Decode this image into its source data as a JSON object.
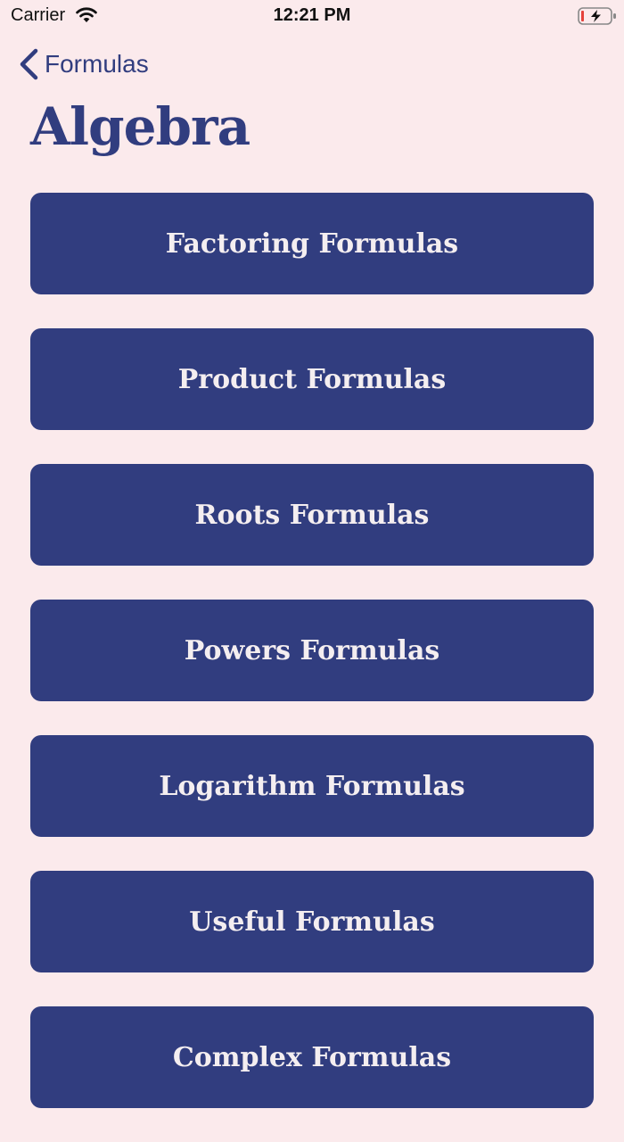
{
  "status_bar": {
    "carrier": "Carrier",
    "time": "12:21 PM",
    "wifi_icon": "wifi-icon",
    "battery_icon": "battery-charging-icon"
  },
  "nav": {
    "back_label": "Formulas",
    "back_icon": "chevron-left-icon"
  },
  "page": {
    "title": "Algebra"
  },
  "buttons": [
    {
      "label": "Factoring Formulas"
    },
    {
      "label": "Product Formulas"
    },
    {
      "label": "Roots Formulas"
    },
    {
      "label": "Powers Formulas"
    },
    {
      "label": "Logarithm Formulas"
    },
    {
      "label": "Useful Formulas"
    },
    {
      "label": "Complex Formulas"
    }
  ],
  "colors": {
    "background": "#fbeaec",
    "accent": "#313d7f",
    "button_text": "#f4eef0",
    "battery_low": "#e5413b"
  }
}
